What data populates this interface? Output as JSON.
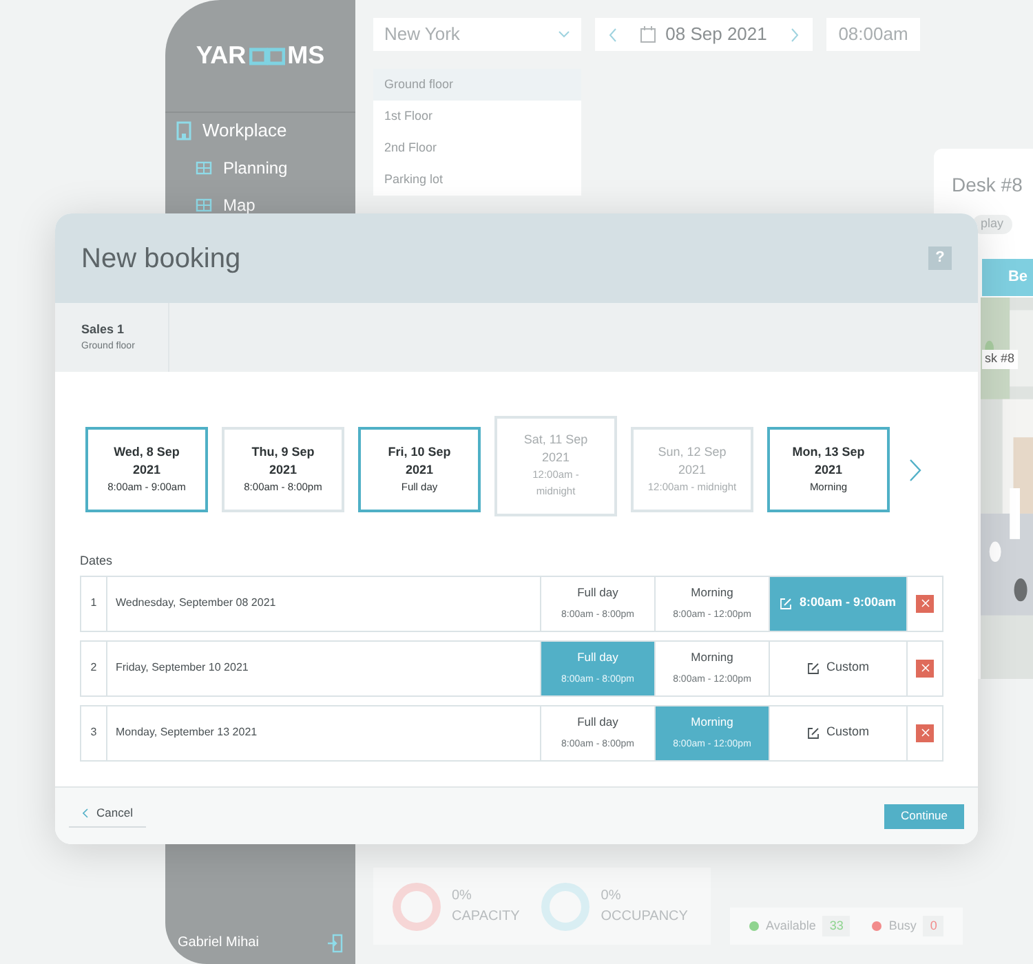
{
  "sidebar": {
    "logo": {
      "left": "YAR",
      "right": "MS"
    },
    "items": [
      {
        "label": "Workplace",
        "children": [
          {
            "label": "Planning"
          },
          {
            "label": "Map"
          }
        ]
      }
    ],
    "user": "Gabriel Mihai"
  },
  "topbar": {
    "location": "New York",
    "date": "08 Sep 2021",
    "time": "08:00am"
  },
  "floors": [
    {
      "label": "Ground floor",
      "selected": true
    },
    {
      "label": "1st Floor",
      "selected": false
    },
    {
      "label": "2nd Floor",
      "selected": false
    },
    {
      "label": "Parking lot",
      "selected": false
    }
  ],
  "desk_panel": {
    "title": "Desk #8",
    "chips": [
      "play"
    ],
    "button": "Be",
    "map_label": "sk #8"
  },
  "stats": [
    {
      "value": "0%",
      "label": "CAPACITY",
      "color": "#f6d6d6"
    },
    {
      "value": "0%",
      "label": "OCCUPANCY",
      "color": "#d9eef3"
    }
  ],
  "legend": [
    {
      "label": "Available",
      "count": "33",
      "color": "#8fd48f"
    },
    {
      "label": "Busy",
      "count": "0",
      "color": "#f28b8b"
    }
  ],
  "modal": {
    "title": "New booking",
    "help": "?",
    "room": {
      "name": "Sales 1",
      "floor": "Ground floor"
    },
    "date_cards": [
      {
        "day": "Wed, 8 Sep 2021",
        "time": "8:00am - 9:00am",
        "selected": true,
        "disabled": false,
        "hovered": false
      },
      {
        "day": "Thu, 9 Sep 2021",
        "time": "8:00am - 8:00pm",
        "selected": false,
        "disabled": false,
        "hovered": false
      },
      {
        "day": "Fri, 10 Sep 2021",
        "time": "Full day",
        "selected": true,
        "disabled": false,
        "hovered": false
      },
      {
        "day": "Sat, 11 Sep 2021",
        "time": "12:00am - midnight",
        "selected": false,
        "disabled": true,
        "hovered": true
      },
      {
        "day": "Sun, 12 Sep 2021",
        "time": "12:00am - midnight",
        "selected": false,
        "disabled": true,
        "hovered": false
      },
      {
        "day": "Mon, 13 Sep 2021",
        "time": "Morning",
        "selected": true,
        "disabled": false,
        "hovered": false
      }
    ],
    "dates_label": "Dates",
    "rows": [
      {
        "index": "1",
        "date": "Wednesday, September 08 2021",
        "options": [
          {
            "kind": "preset",
            "title": "Full day",
            "time": "8:00am - 8:00pm",
            "selected": false
          },
          {
            "kind": "preset",
            "title": "Morning",
            "time": "8:00am - 12:00pm",
            "selected": false
          },
          {
            "kind": "custom",
            "title": "8:00am - 9:00am",
            "selected": true
          }
        ]
      },
      {
        "index": "2",
        "date": "Friday, September 10 2021",
        "options": [
          {
            "kind": "preset",
            "title": "Full day",
            "time": "8:00am - 8:00pm",
            "selected": true
          },
          {
            "kind": "preset",
            "title": "Morning",
            "time": "8:00am - 12:00pm",
            "selected": false
          },
          {
            "kind": "custom",
            "title": "Custom",
            "selected": false
          }
        ]
      },
      {
        "index": "3",
        "date": "Monday, September 13 2021",
        "options": [
          {
            "kind": "preset",
            "title": "Full day",
            "time": "8:00am - 8:00pm",
            "selected": false
          },
          {
            "kind": "preset",
            "title": "Morning",
            "time": "8:00am - 12:00pm",
            "selected": true
          },
          {
            "kind": "custom",
            "title": "Custom",
            "selected": false
          }
        ]
      }
    ],
    "cancel": "Cancel",
    "continue": "Continue"
  }
}
